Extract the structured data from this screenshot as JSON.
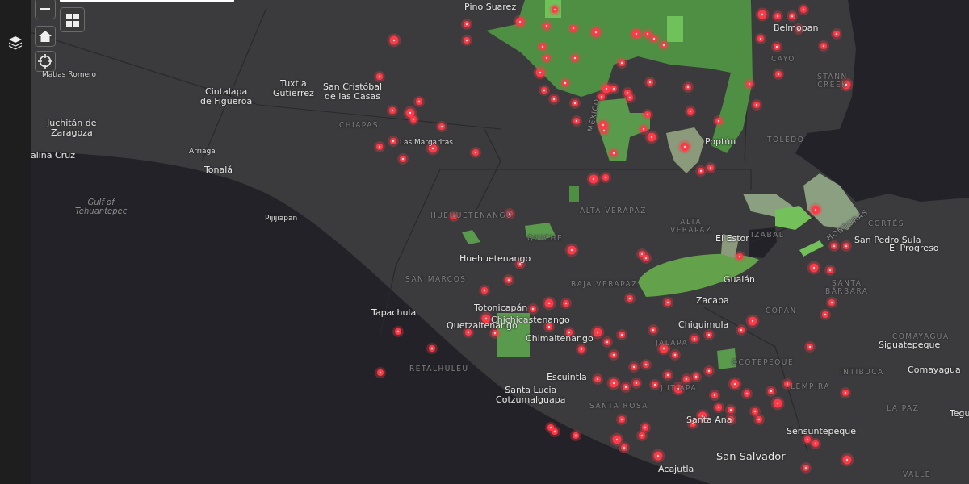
{
  "map": {
    "labels": [
      {
        "text": "Pino Suarez",
        "kind": "city"
      },
      {
        "text": "Belmopan",
        "kind": "city"
      },
      {
        "text": "CAYO",
        "kind": "region"
      },
      {
        "text": "STANN\nCREEK",
        "kind": "region"
      },
      {
        "text": "TOLEDO",
        "kind": "region"
      },
      {
        "text": "Matías Romero",
        "kind": "small"
      },
      {
        "text": "Cintalapa\nde Figueroa",
        "kind": "city"
      },
      {
        "text": "Tuxtla\nGutierrez",
        "kind": "city"
      },
      {
        "text": "San Cristóbal\nde las Casas",
        "kind": "city"
      },
      {
        "text": "CHIAPAS",
        "kind": "region"
      },
      {
        "text": "Las Margaritas",
        "kind": "small"
      },
      {
        "text": "Juchitán de\nZaragoza",
        "kind": "city"
      },
      {
        "text": "alina Cruz",
        "kind": "city"
      },
      {
        "text": "Arriaga",
        "kind": "small"
      },
      {
        "text": "Tonalá",
        "kind": "city"
      },
      {
        "text": "Gulf of\nTehuantepec",
        "kind": "water"
      },
      {
        "text": "Pijijiapan",
        "kind": "small"
      },
      {
        "text": "Poptún",
        "kind": "city"
      },
      {
        "text": "MEXICO",
        "kind": "border"
      },
      {
        "text": "HUEHUETENANGO",
        "kind": "region"
      },
      {
        "text": "ALTA VERAPAZ",
        "kind": "region"
      },
      {
        "text": "ALTA\nVERAPAZ",
        "kind": "region"
      },
      {
        "text": "QUICHE",
        "kind": "region"
      },
      {
        "text": "El Estor",
        "kind": "city"
      },
      {
        "text": "IZABAL",
        "kind": "region"
      },
      {
        "text": "HONDURAS",
        "kind": "border"
      },
      {
        "text": "CORTÉS",
        "kind": "region"
      },
      {
        "text": "San Pedro Sula",
        "kind": "city"
      },
      {
        "text": "El Progreso",
        "kind": "city"
      },
      {
        "text": "Huehuetenango",
        "kind": "city"
      },
      {
        "text": "SAN MARCOS",
        "kind": "region"
      },
      {
        "text": "BAJA VERAPAZ",
        "kind": "region"
      },
      {
        "text": "Gualán",
        "kind": "city"
      },
      {
        "text": "SANTA\nBÁRBARA",
        "kind": "region"
      },
      {
        "text": "Zacapa",
        "kind": "city"
      },
      {
        "text": "Tapachula",
        "kind": "city"
      },
      {
        "text": "Totonicapán",
        "kind": "city"
      },
      {
        "text": "COPÁN",
        "kind": "region"
      },
      {
        "text": "Chichicastenango",
        "kind": "city"
      },
      {
        "text": "Quetzaltenango",
        "kind": "city"
      },
      {
        "text": "Chiquimula",
        "kind": "city"
      },
      {
        "text": "Chimaltenango",
        "kind": "city"
      },
      {
        "text": "JALAPA",
        "kind": "region"
      },
      {
        "text": "COMAYAGUA",
        "kind": "region"
      },
      {
        "text": "Siguatepeque",
        "kind": "city"
      },
      {
        "text": "OCOTEPEQUE",
        "kind": "region"
      },
      {
        "text": "RETALHULEU",
        "kind": "region"
      },
      {
        "text": "INTIBUCA",
        "kind": "region"
      },
      {
        "text": "Comayagua",
        "kind": "city"
      },
      {
        "text": "Escuintla",
        "kind": "city"
      },
      {
        "text": "Santa Lucia\nCotzumalguapa",
        "kind": "city"
      },
      {
        "text": "JUTIAPA",
        "kind": "region"
      },
      {
        "text": "LEMPIRA",
        "kind": "region"
      },
      {
        "text": "SANTA ROSA",
        "kind": "region"
      },
      {
        "text": "LA PAZ",
        "kind": "region"
      },
      {
        "text": "Tegu",
        "kind": "city"
      },
      {
        "text": "Santa Ana",
        "kind": "city"
      },
      {
        "text": "Sensuntepeque",
        "kind": "city"
      },
      {
        "text": "San Salvador",
        "kind": "capital"
      },
      {
        "text": "Acajutla",
        "kind": "city"
      },
      {
        "text": "VALLE",
        "kind": "region"
      }
    ]
  }
}
